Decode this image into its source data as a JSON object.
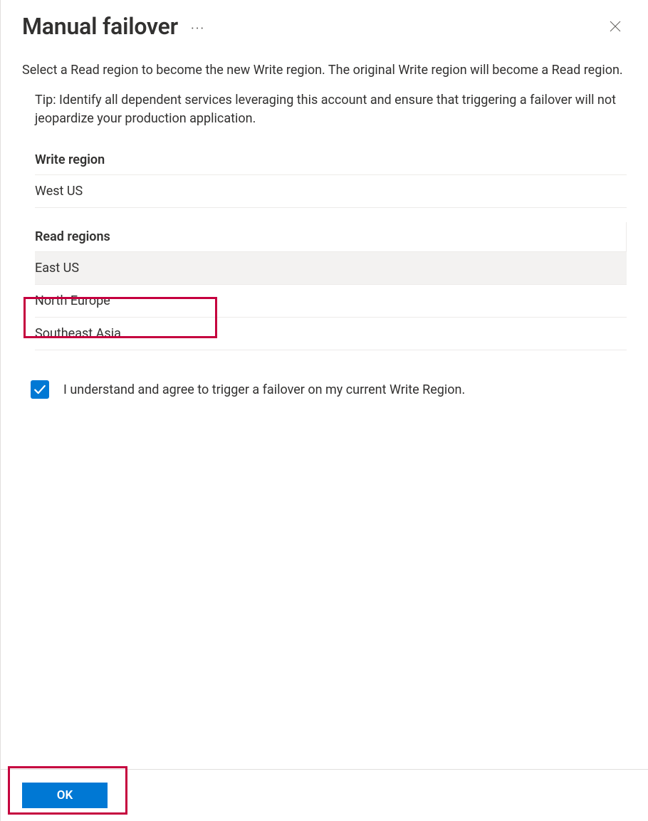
{
  "header": {
    "title": "Manual failover"
  },
  "description": "Select a Read region to become the new Write region. The original Write region will become a Read region.",
  "tip": "Tip: Identify all dependent services leveraging this account and ensure that triggering a failover will not jeopardize your production application.",
  "writeRegion": {
    "header": "Write region",
    "value": "West US"
  },
  "readRegions": {
    "header": "Read regions",
    "items": [
      {
        "name": "East US",
        "selected": true
      },
      {
        "name": "North Europe",
        "selected": false
      },
      {
        "name": "Southeast Asia",
        "selected": false
      }
    ]
  },
  "confirm": {
    "label": "I understand and agree to trigger a failover on my current Write Region.",
    "checked": true
  },
  "footer": {
    "okLabel": "OK"
  }
}
